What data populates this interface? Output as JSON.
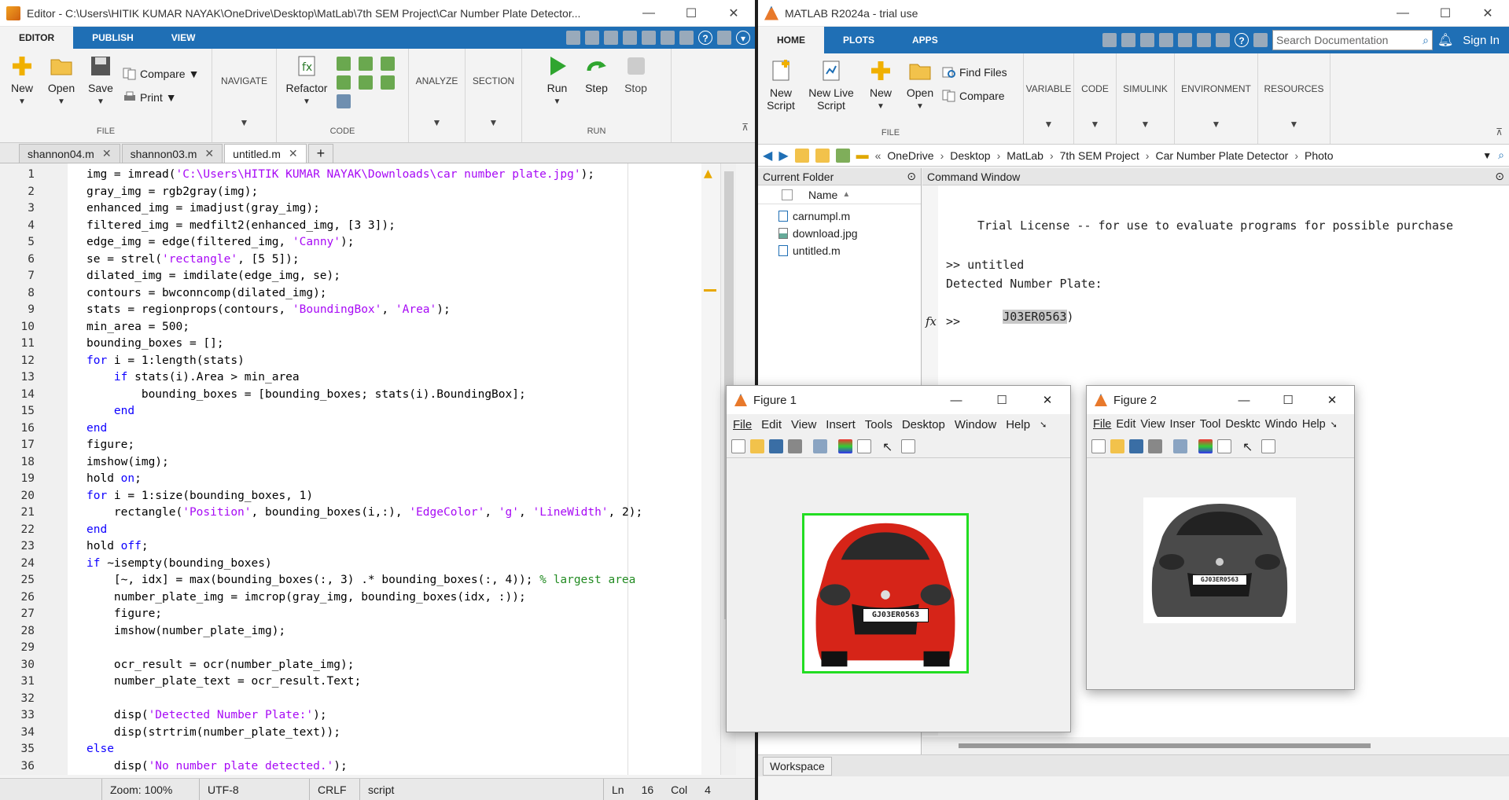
{
  "editor": {
    "title": "Editor - C:\\Users\\HITIK KUMAR NAYAK\\OneDrive\\Desktop\\MatLab\\7th SEM Project\\Car Number Plate Detector...",
    "ribbon_tabs": [
      "EDITOR",
      "PUBLISH",
      "VIEW"
    ],
    "file_group": {
      "new": "New",
      "open": "Open",
      "save": "Save",
      "compare": "Compare",
      "print": "Print",
      "label": "FILE"
    },
    "navigate": "NAVIGATE",
    "code_group": {
      "refactor": "Refactor",
      "label": "CODE"
    },
    "analyze": "ANALYZE",
    "section": "SECTION",
    "run_group": {
      "run": "Run",
      "step": "Step",
      "stop": "Stop",
      "label": "RUN"
    },
    "tabs": [
      "shannon04.m",
      "shannon03.m",
      "untitled.m"
    ],
    "lines": [
      {
        "n": "1",
        "t": "img = imread('C:\\Users\\HITIK KUMAR NAYAK\\Downloads\\car number plate.jpg');"
      },
      {
        "n": "2",
        "t": "gray_img = rgb2gray(img);"
      },
      {
        "n": "3",
        "t": "enhanced_img = imadjust(gray_img);"
      },
      {
        "n": "4",
        "t": "filtered_img = medfilt2(enhanced_img, [3 3]);"
      },
      {
        "n": "5",
        "t": "edge_img = edge(filtered_img, 'Canny');"
      },
      {
        "n": "6",
        "t": "se = strel('rectangle', [5 5]);"
      },
      {
        "n": "7",
        "t": "dilated_img = imdilate(edge_img, se);"
      },
      {
        "n": "8",
        "t": "contours = bwconncomp(dilated_img);"
      },
      {
        "n": "9",
        "t": "stats = regionprops(contours, 'BoundingBox', 'Area');"
      },
      {
        "n": "10",
        "t": "min_area = 500;"
      },
      {
        "n": "11",
        "t": "bounding_boxes = [];"
      },
      {
        "n": "12",
        "t": "for i = 1:length(stats)"
      },
      {
        "n": "13",
        "t": "    if stats(i).Area > min_area"
      },
      {
        "n": "14",
        "t": "        bounding_boxes = [bounding_boxes; stats(i).BoundingBox];"
      },
      {
        "n": "15",
        "t": "    end"
      },
      {
        "n": "16",
        "t": "end"
      },
      {
        "n": "17",
        "t": "figure;"
      },
      {
        "n": "18",
        "t": "imshow(img);"
      },
      {
        "n": "19",
        "t": "hold on;"
      },
      {
        "n": "20",
        "t": "for i = 1:size(bounding_boxes, 1)"
      },
      {
        "n": "21",
        "t": "    rectangle('Position', bounding_boxes(i,:), 'EdgeColor', 'g', 'LineWidth', 2);"
      },
      {
        "n": "22",
        "t": "end"
      },
      {
        "n": "23",
        "t": "hold off;"
      },
      {
        "n": "24",
        "t": "if ~isempty(bounding_boxes)"
      },
      {
        "n": "25",
        "t": "    [~, idx] = max(bounding_boxes(:, 3) .* bounding_boxes(:, 4)); % largest area"
      },
      {
        "n": "26",
        "t": "    number_plate_img = imcrop(gray_img, bounding_boxes(idx, :));"
      },
      {
        "n": "27",
        "t": "    figure;"
      },
      {
        "n": "28",
        "t": "    imshow(number_plate_img);"
      },
      {
        "n": "29",
        "t": ""
      },
      {
        "n": "30",
        "t": "    ocr_result = ocr(number_plate_img);"
      },
      {
        "n": "31",
        "t": "    number_plate_text = ocr_result.Text;"
      },
      {
        "n": "32",
        "t": ""
      },
      {
        "n": "33",
        "t": "    disp('Detected Number Plate:');"
      },
      {
        "n": "34",
        "t": "    disp(strtrim(number_plate_text));"
      },
      {
        "n": "35",
        "t": "else"
      },
      {
        "n": "36",
        "t": "    disp('No number plate detected.');"
      }
    ],
    "status": {
      "zoom": "Zoom: 100%",
      "encoding": "UTF-8",
      "eol": "CRLF",
      "type": "script",
      "ln_label": "Ln",
      "ln": "16",
      "col_label": "Col",
      "col": "4"
    }
  },
  "matlab": {
    "title": "MATLAB R2024a - trial use",
    "ribbon_tabs": [
      "HOME",
      "PLOTS",
      "APPS"
    ],
    "search_placeholder": "Search Documentation",
    "sign_in": "Sign In",
    "file_group": {
      "new_script": "New Script",
      "new_live_script": "New Live Script",
      "new": "New",
      "open": "Open",
      "find_files": "Find Files",
      "compare": "Compare",
      "label": "FILE"
    },
    "collapsed_groups": [
      "VARIABLE",
      "CODE",
      "SIMULINK",
      "ENVIRONMENT",
      "RESOURCES"
    ],
    "path": [
      "OneDrive",
      "Desktop",
      "MatLab",
      "7th SEM Project",
      "Car Number Plate Detector",
      "Photo"
    ],
    "current_folder": "Current Folder",
    "name_col": "Name",
    "files": [
      "carnumpl.m",
      "download.jpg",
      "untitled.m"
    ],
    "command_window": "Command Window",
    "cmd": {
      "license": "Trial License -- for use to evaluate programs for possible purchase",
      "prompt_cmd": ">> untitled",
      "detected": "Detected Number Plate:",
      "result": "J03ER0563",
      "result_tail": ")",
      "prompt": ">>"
    },
    "workspace": "Workspace"
  },
  "figure1": {
    "title": "Figure 1",
    "menu": [
      "File",
      "Edit",
      "View",
      "Insert",
      "Tools",
      "Desktop",
      "Window",
      "Help"
    ],
    "plate": "GJ03ER0563"
  },
  "figure2": {
    "title": "Figure 2",
    "menu": [
      "File",
      "Edit",
      "View",
      "Inser",
      "Tool",
      "Desktc",
      "Windo",
      "Help"
    ],
    "plate": "GJ03ER0563"
  }
}
